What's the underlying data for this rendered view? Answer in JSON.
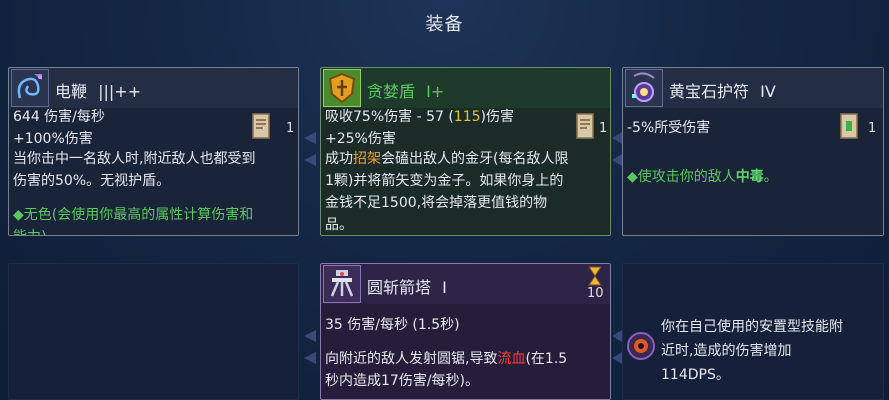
{
  "header": {
    "title": "装备"
  },
  "cards": {
    "whip": {
      "name": "电鞭",
      "tier": "|||++",
      "dps": "644 伤害/每秒",
      "bonus": "+100%伤害",
      "count": "1",
      "desc1": "当你击中一名敌人时,附近敌人也都受到",
      "desc2": "伤害的50%。无视护盾。",
      "trait": "◆无色(会使用你最高的属性计算伤害和",
      "trait_cut": "能力)"
    },
    "shield": {
      "name": "贪婪盾",
      "tier": "I+",
      "stat_a": "吸收75%伤害 - 57 (",
      "stat_num": "115",
      "stat_b": ")伤害",
      "bonus": "+25%伤害",
      "count": "1",
      "d1a": "成功",
      "d1_parry": "招架",
      "d1b": "会磕出敌人的金牙(每名敌人限",
      "d2": "1颗)并将箭矢变为金子。如果你身上的",
      "d3": "金钱不足1500,将会掉落更值钱的物",
      "d4": "品。"
    },
    "amulet": {
      "name": "黄宝石护符",
      "tier": "IV",
      "stat": "-5%所受伤害",
      "count": "1",
      "poison_a": "◆使攻击你的敌人",
      "poison_b": "中毒",
      "poison_c": "。"
    },
    "turret": {
      "name": "圆斩箭塔",
      "tier": "I",
      "cooldown": "10",
      "dps": "35 伤害/每秒 (1.5秒)",
      "d1a": "向附近的敌人发射圆锯,导致",
      "d1_bleed": "流血",
      "d1b": "(在1.5",
      "d2": "秒内造成17伤害/每秒)。"
    },
    "mutation": {
      "l1": "你在自己使用的安置型技能附",
      "l2": "近时,造成的伤害增加",
      "l3": "114DPS。"
    }
  },
  "colors": {
    "green_border": "#6a8d72",
    "purple_border": "#8a78a8",
    "amber": "#e2c43a",
    "bleed_red": "#f04040",
    "poison_green": "#5fd86a"
  }
}
